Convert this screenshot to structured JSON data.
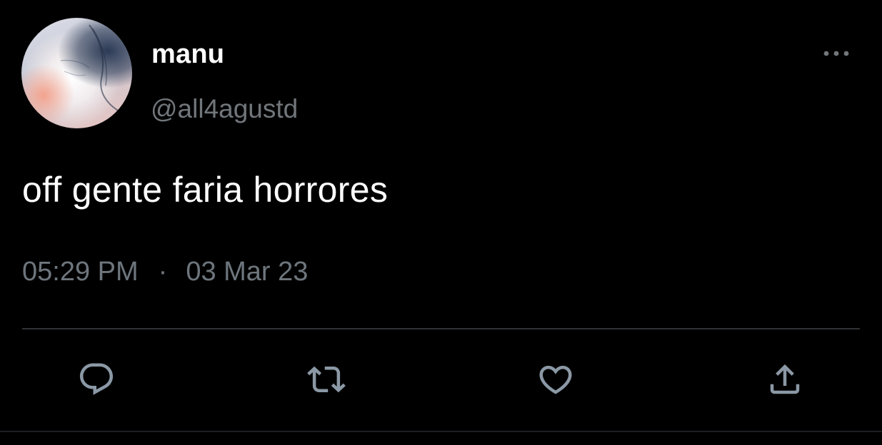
{
  "user": {
    "display_name": "manu",
    "handle": "@all4agustd",
    "avatar_icon": "avatar-image"
  },
  "tweet": {
    "text": "off gente faria horrores",
    "time": "05:29 PM",
    "separator": "·",
    "date": "03 Mar 23"
  },
  "actions": {
    "reply_icon": "reply-icon",
    "retweet_icon": "retweet-icon",
    "like_icon": "heart-icon",
    "share_icon": "share-icon"
  },
  "colors": {
    "background": "#000000",
    "primary_text": "#ffffff",
    "secondary_text": "#71767b",
    "icon": "#8b98a5",
    "divider": "#2f3336"
  }
}
